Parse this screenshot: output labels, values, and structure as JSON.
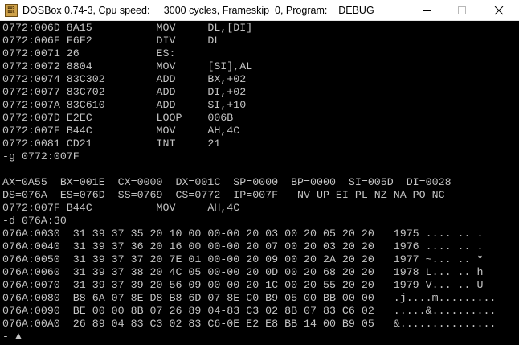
{
  "window": {
    "icon_text": [
      "DOS",
      "BOX"
    ],
    "title": "DOSBox 0.74-3, Cpu speed:     3000 cycles, Frameskip  0, Program:    DEBUG"
  },
  "console": {
    "lines": [
      "0772:006D 8A15          MOV     DL,[DI]",
      "0772:006F F6F2          DIV     DL",
      "0772:0071 26            ES:",
      "0772:0072 8804          MOV     [SI],AL",
      "0772:0074 83C302        ADD     BX,+02",
      "0772:0077 83C702        ADD     DI,+02",
      "0772:007A 83C610        ADD     SI,+10",
      "0772:007D E2EC          LOOP    006B",
      "0772:007F B44C          MOV     AH,4C",
      "0772:0081 CD21          INT     21",
      "-g 0772:007F",
      "",
      "AX=0A55  BX=001E  CX=0000  DX=001C  SP=0000  BP=0000  SI=005D  DI=0028",
      "DS=076A  ES=076D  SS=0769  CS=0772  IP=007F   NV UP EI PL NZ NA PO NC",
      "0772:007F B44C          MOV     AH,4C",
      "-d 076A:30",
      "076A:0030  31 39 37 35 20 10 00 00-00 20 03 00 20 05 20 20   1975 .... .. .",
      "076A:0040  31 39 37 36 20 16 00 00-00 20 07 00 20 03 20 20   1976 .... .. .",
      "076A:0050  31 39 37 37 20 7E 01 00-00 20 09 00 20 2A 20 20   1977 ~... .. *",
      "076A:0060  31 39 37 38 20 4C 05 00-00 20 0D 00 20 68 20 20   1978 L... .. h",
      "076A:0070  31 39 37 39 20 56 09 00-00 20 1C 00 20 55 20 20   1979 V... .. U",
      "076A:0080  B8 6A 07 8E D8 B8 6D 07-8E C0 B9 05 00 BB 00 00   .j....m.........",
      "076A:0090  BE 00 00 8B 07 26 89 04-83 C3 02 8B 07 83 C6 02   .....&..........",
      "076A:00A0  26 89 04 83 C3 02 83 C6-0E E2 E8 BB 14 00 B9 05   &...............",
      "- ▲"
    ]
  }
}
